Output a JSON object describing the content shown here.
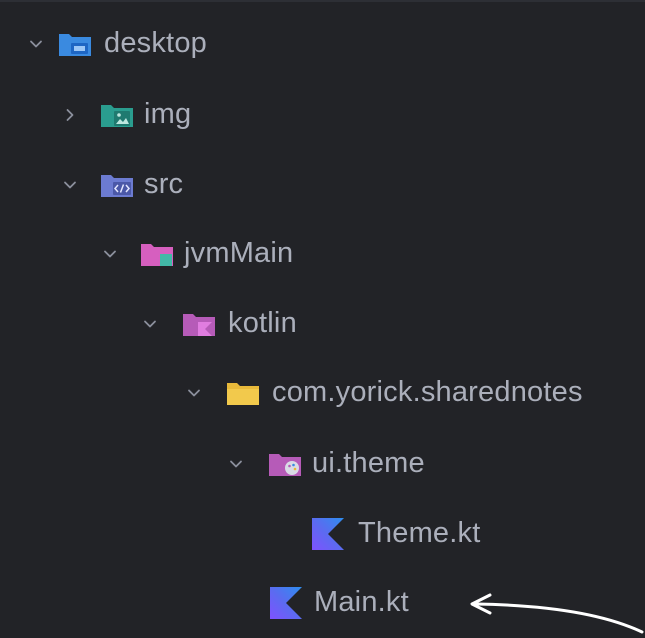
{
  "tree": {
    "items": [
      {
        "label": "desktop",
        "expanded": true,
        "icon": "module-folder-icon"
      },
      {
        "label": "img",
        "expanded": false,
        "icon": "resources-folder-icon"
      },
      {
        "label": "src",
        "expanded": true,
        "icon": "source-folder-icon"
      },
      {
        "label": "jvmMain",
        "expanded": true,
        "icon": "source-set-folder-icon"
      },
      {
        "label": "kotlin",
        "expanded": true,
        "icon": "kotlin-source-root-icon"
      },
      {
        "label": "com.yorick.sharednotes",
        "expanded": true,
        "icon": "package-folder-icon"
      },
      {
        "label": "ui.theme",
        "expanded": true,
        "icon": "theme-package-icon"
      },
      {
        "label": "Theme.kt",
        "icon": "kotlin-file-icon"
      },
      {
        "label": "Main.kt",
        "icon": "kotlin-file-icon"
      }
    ]
  },
  "annotation": {
    "icon": "curved-arrow-icon",
    "color": "#ffffff"
  },
  "colors": {
    "background": "#222327",
    "text": "#abafbb",
    "module_blue": "#3a8ae0",
    "resources_teal": "#2a9d8f",
    "source_lavender": "#6c7bd1",
    "sourceset_pink": "#d65fbf",
    "package_yellow": "#e8b93a",
    "kotlin_purple": "#8a63d2"
  }
}
